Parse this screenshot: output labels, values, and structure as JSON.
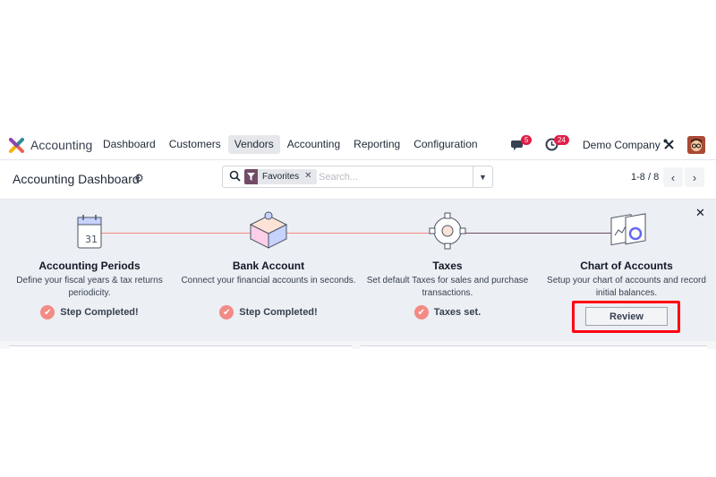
{
  "nav": {
    "app_name": "Accounting",
    "menu": [
      {
        "label": "Dashboard"
      },
      {
        "label": "Customers"
      },
      {
        "label": "Vendors"
      },
      {
        "label": "Accounting"
      },
      {
        "label": "Reporting"
      },
      {
        "label": "Configuration"
      }
    ],
    "messages_count": "5",
    "activities_count": "24",
    "company": "Demo Company"
  },
  "control_panel": {
    "title": "Accounting Dashboard",
    "facet_label": "Favorites",
    "search_placeholder": "Search...",
    "pager": "1-8 / 8"
  },
  "onboarding": {
    "steps": [
      {
        "title": "Accounting Periods",
        "description": "Define your fiscal years & tax returns periodicity.",
        "status": "Step Completed!"
      },
      {
        "title": "Bank Account",
        "description": "Connect your financial accounts in seconds.",
        "status": "Step Completed!"
      },
      {
        "title": "Taxes",
        "description": "Set default Taxes for sales and purchase transactions.",
        "status": "Taxes set."
      },
      {
        "title": "Chart of Accounts",
        "description": "Setup your chart of accounts and record initial balances.",
        "action": "Review"
      }
    ]
  },
  "colors": {
    "brand": "#714b67",
    "badge": "#e11d48",
    "check": "#f28b85",
    "highlight": "#ff0014"
  }
}
